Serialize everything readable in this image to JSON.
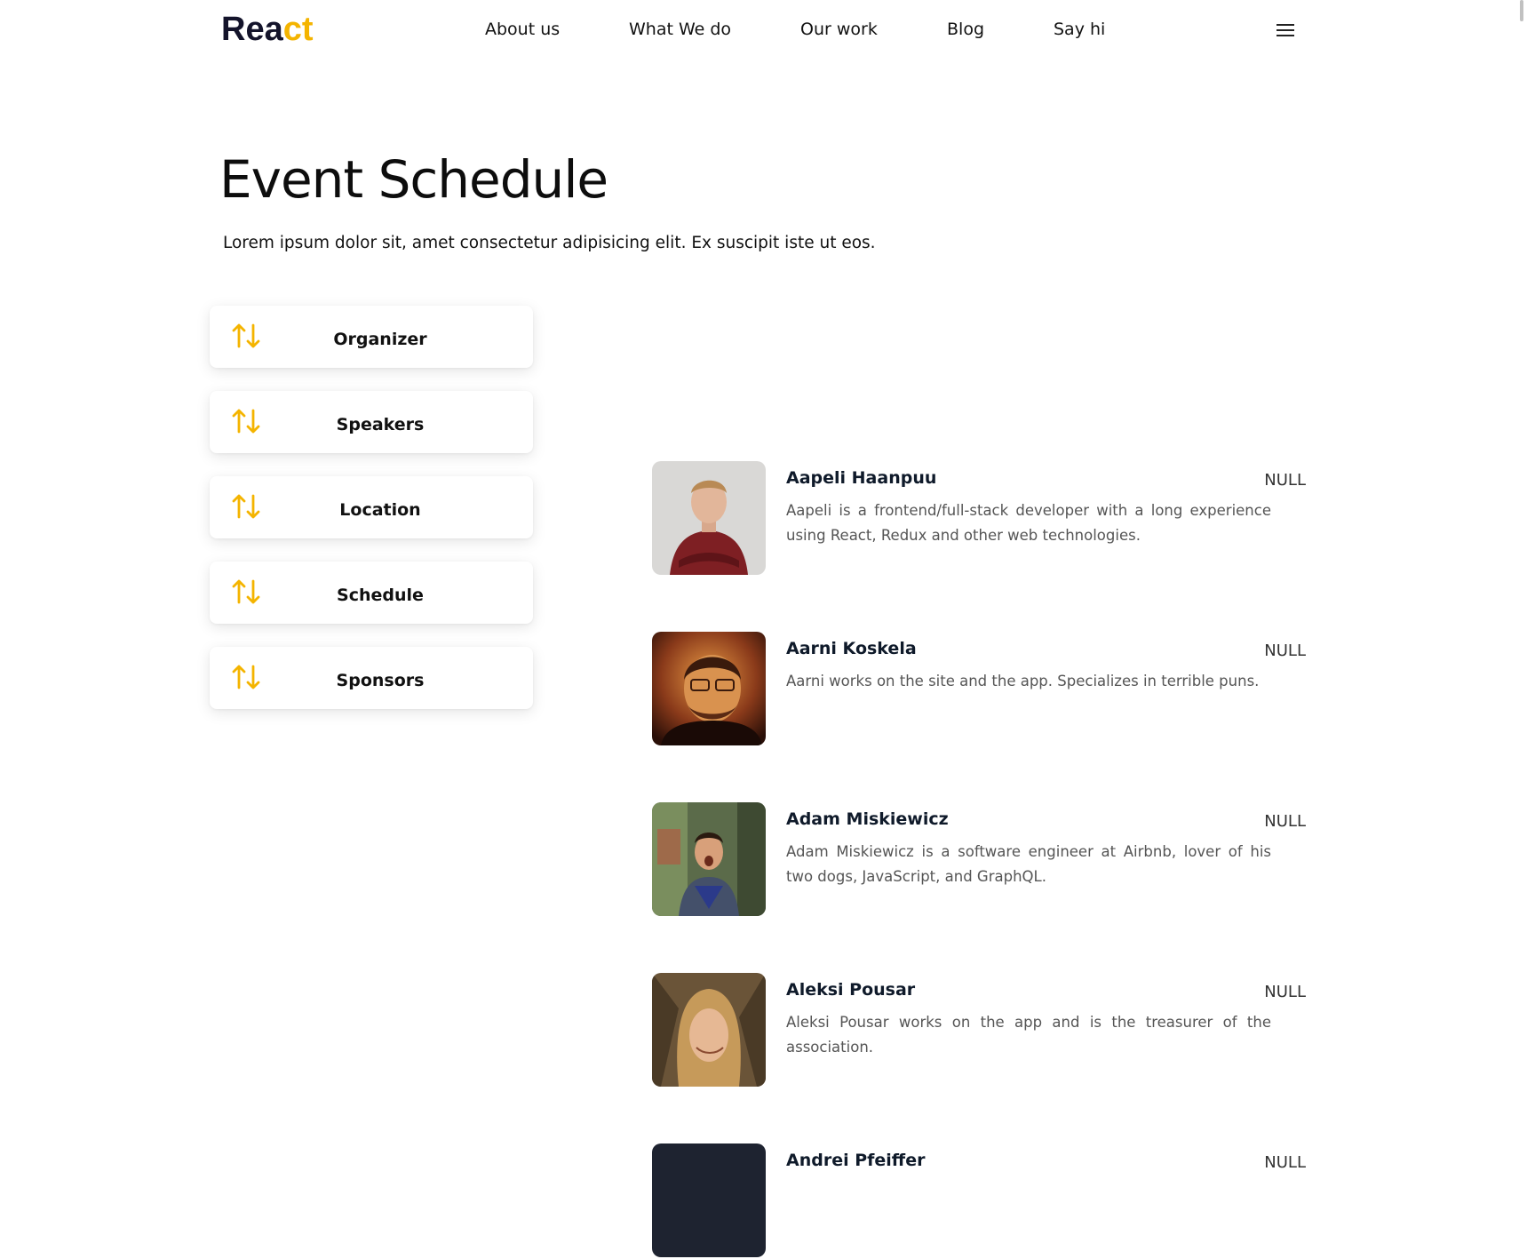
{
  "brand": {
    "logo_main": "Rea",
    "logo_accent": "ct",
    "accent_color": "#f4b400"
  },
  "nav": {
    "items": [
      {
        "label": "About us"
      },
      {
        "label": "What We do"
      },
      {
        "label": "Our work"
      },
      {
        "label": "Blog"
      },
      {
        "label": "Say hi"
      }
    ],
    "menu_icon": "hamburger-menu-icon"
  },
  "hero": {
    "title": "Event Schedule",
    "subtitle": "Lorem ipsum dolor sit, amet consectetur adipisicing elit. Ex suscipit iste ut eos."
  },
  "accordion": {
    "icon": "sort-arrows-icon",
    "items": [
      {
        "label": "Organizer"
      },
      {
        "label": "Speakers"
      },
      {
        "label": "Location"
      },
      {
        "label": "Schedule"
      },
      {
        "label": "Sponsors"
      }
    ]
  },
  "speakers": [
    {
      "name": "Aapeli Haanpuu",
      "tag": "NULL",
      "bio": "Aapeli is a frontend/full-stack developer with a long experience using React, Redux and other web technologies."
    },
    {
      "name": "Aarni Koskela",
      "tag": "NULL",
      "bio": "Aarni works on the site and the app. Specializes in terrible puns."
    },
    {
      "name": "Adam Miskiewicz",
      "tag": "NULL",
      "bio": "Adam Miskiewicz is a software engineer at Airbnb, lover of his two dogs, JavaScript, and GraphQL."
    },
    {
      "name": "Aleksi Pousar",
      "tag": "NULL",
      "bio": "Aleksi Pousar works on the app and is the treasurer of the association."
    },
    {
      "name": "Andrei Pfeiffer",
      "tag": "NULL",
      "bio": ""
    }
  ]
}
